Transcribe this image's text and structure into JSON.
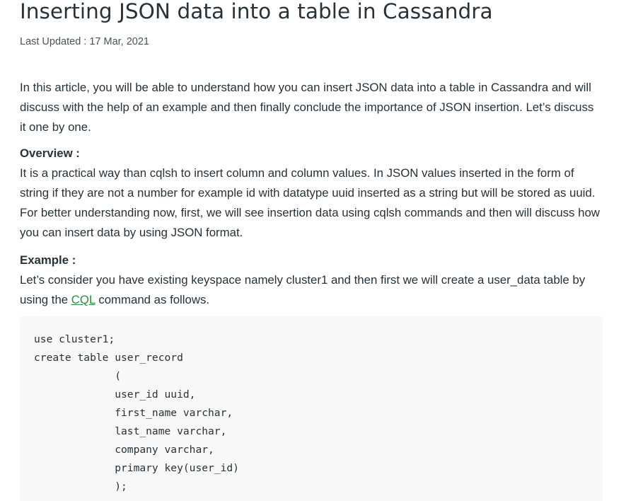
{
  "article": {
    "title": "Inserting JSON data into a table in Cassandra",
    "last_updated": "Last Updated : 17 Mar, 2021",
    "intro": "In this article, you will be able to understand how you can insert JSON data into a table in Cassandra and will discuss with the help of an example and then finally conclude the importance of JSON insertion. Let’s discuss it one by one.",
    "overview_heading": "Overview :",
    "overview_text": "It is a practical way than cqlsh to insert column and column values. In JSON values inserted in the form of string if they are not a number for example id with datatype uuid inserted as a string but will be stored as uuid. For better understanding now, first, we will see insertion data using cqlsh commands and then will discuss how you can insert data by using JSON format.",
    "example_heading": "Example :",
    "example_text_before": "Let’s consider you have existing keyspace namely cluster1 and then first we will create a user_data table by using the ",
    "example_link": "CQL",
    "example_text_after": " command as follows.",
    "code": "use cluster1;\ncreate table user_record\n             (\n             user_id uuid,\n             first_name varchar,\n             last_name varchar,\n             company varchar,\n             primary key(user_id)\n             );"
  }
}
